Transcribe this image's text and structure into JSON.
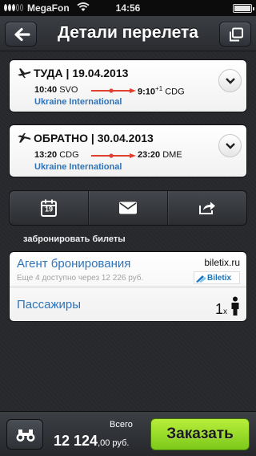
{
  "status_bar": {
    "carrier": "MegaFon",
    "time": "14:56"
  },
  "nav": {
    "title": "Детали перелета"
  },
  "flights": {
    "outbound": {
      "direction": "ТУДА",
      "date": "19.04.2013",
      "departure_time": "10:40",
      "departure_airport": "SVO",
      "arrival_time": "9:10",
      "arrival_day_offset": "+1",
      "arrival_airport": "CDG",
      "airline": "Ukraine International"
    },
    "return": {
      "direction": "ОБРАТНО",
      "date": "30.04.2013",
      "departure_time": "13:20",
      "departure_airport": "CDG",
      "arrival_time": "23:20",
      "arrival_airport": "DME",
      "airline": "Ukraine International"
    }
  },
  "actions": {
    "calendar_day": "19"
  },
  "booking": {
    "section_label": "забронировать билеты",
    "agent_title": "Агент бронирования",
    "agent_subtitle": "Еще 4 доступно через 12 226 руб.",
    "agent_site": "biletix.ru",
    "agent_logo_text": "Biletix",
    "passengers_title": "Пассажиры",
    "passenger_count": "1",
    "passenger_multiplier": "x"
  },
  "footer": {
    "total_label": "Всего",
    "total_amount": "12 124",
    "total_cents": ",00 руб.",
    "order_label": "Заказать"
  },
  "colors": {
    "link_blue": "#2f73b8",
    "route_red": "#e04030",
    "order_green": "#9ddc2a"
  }
}
